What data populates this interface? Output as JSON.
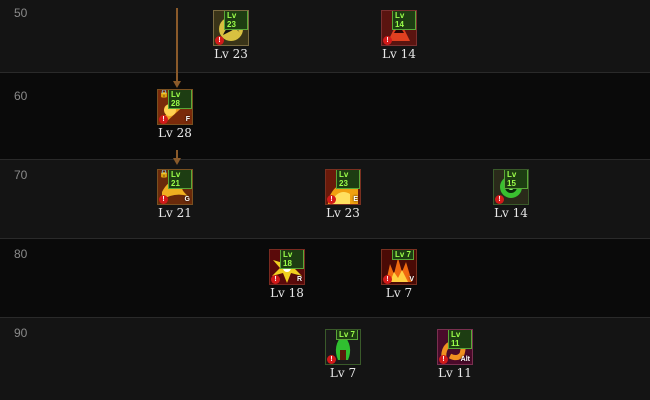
{
  "rows": [
    {
      "level": "50"
    },
    {
      "level": "60"
    },
    {
      "level": "70"
    },
    {
      "level": "80"
    },
    {
      "level": "90"
    }
  ],
  "skills": [
    {
      "id": "s50a",
      "badge": "Lv 23",
      "label": "Lv 23",
      "key": "",
      "icon": "hooded-figure-icon",
      "border": "#7a6a40",
      "bg": "#3a3418",
      "fg": "#d8c040",
      "locked": false
    },
    {
      "id": "s50b",
      "badge": "Lv 14",
      "label": "Lv 14",
      "key": "",
      "icon": "demon-face-icon",
      "border": "#7a3030",
      "bg": "#5a1410",
      "fg": "#e04020",
      "locked": false
    },
    {
      "id": "s60a",
      "badge": "Lv 28",
      "label": "Lv 28",
      "key": "F",
      "icon": "flame-slash-icon",
      "border": "#7a5020",
      "bg": "#7a2a0a",
      "fg": "#f0a020",
      "locked": true
    },
    {
      "id": "s70a",
      "badge": "Lv 21",
      "label": "Lv 21",
      "key": "G",
      "icon": "fire-dragon-icon",
      "border": "#7a5020",
      "bg": "#6a2a0a",
      "fg": "#f0b020",
      "locked": true
    },
    {
      "id": "s70b",
      "badge": "Lv 23",
      "label": "Lv 23",
      "key": "E",
      "icon": "fire-wave-icon",
      "border": "#7a3020",
      "bg": "#6a1a0a",
      "fg": "#f0a010",
      "locked": false
    },
    {
      "id": "s70c",
      "badge": "Lv 15",
      "label": "Lv 14",
      "key": "",
      "icon": "green-orb-icon",
      "border": "#3a5a2a",
      "bg": "#2a2a1a",
      "fg": "#3ac030",
      "locked": false
    },
    {
      "id": "s80a",
      "badge": "Lv 18",
      "label": "Lv 18",
      "key": "R",
      "icon": "explosion-icon",
      "border": "#7a2a20",
      "bg": "#5a0a0a",
      "fg": "#f0d020",
      "locked": false
    },
    {
      "id": "s80b",
      "badge": "Lv 7",
      "label": "Lv 7",
      "key": "V",
      "icon": "fire-burst-icon",
      "border": "#7a3020",
      "bg": "#4a0a05",
      "fg": "#f06a10",
      "locked": false
    },
    {
      "id": "s90a",
      "badge": "Lv 7",
      "label": "Lv 7",
      "key": "",
      "icon": "green-flame-icon",
      "border": "#3a5a2a",
      "bg": "#1a1a1a",
      "fg": "#30c030",
      "locked": false
    },
    {
      "id": "s90b",
      "badge": "Lv 11",
      "label": "Lv 11",
      "key": "Alt",
      "icon": "fire-serpent-icon",
      "border": "#7a3050",
      "bg": "#4a0a2a",
      "fg": "#f09020",
      "locked": false
    }
  ],
  "prereq_arrows": [
    {
      "from": "s50-branch",
      "to": "s60a"
    },
    {
      "from": "s60a",
      "to": "s70a"
    }
  ]
}
